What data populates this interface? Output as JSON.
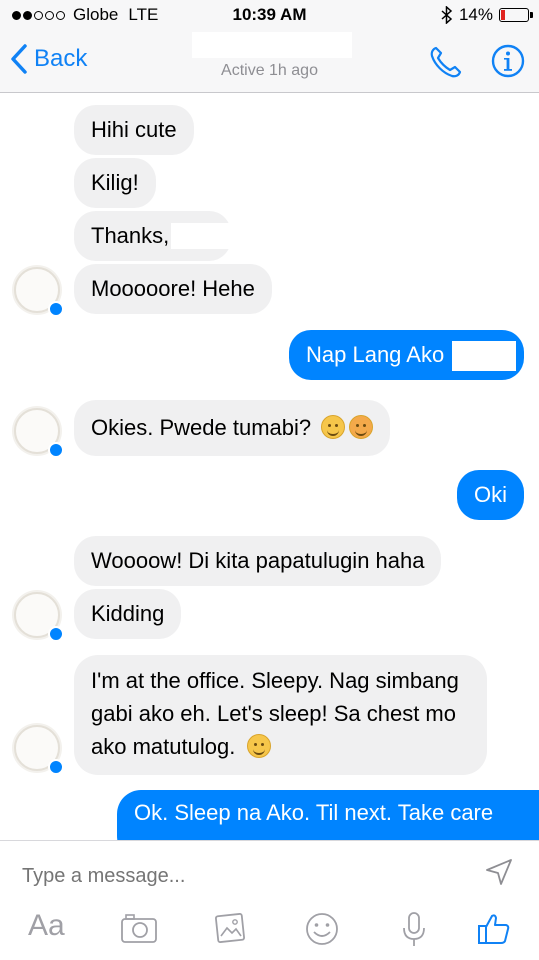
{
  "status_bar": {
    "carrier": "Globe",
    "network": "LTE",
    "time": "10:39 AM",
    "battery": "14%",
    "battery_level": 0.14
  },
  "header": {
    "back_label": "Back",
    "subtitle": "Active 1h ago",
    "icons": [
      "phone-icon",
      "info-icon"
    ]
  },
  "messages": [
    {
      "from": "them",
      "text": "Hihi cute"
    },
    {
      "from": "them",
      "text": "Kilig!"
    },
    {
      "from": "them",
      "text": "Thanks,"
    },
    {
      "from": "them",
      "text": "Mooooore! Hehe"
    },
    {
      "from": "me",
      "text": "Nap Lang Ako"
    },
    {
      "from": "them",
      "text": "Okies. Pwede tumabi?",
      "emoji": [
        "grin-emoji",
        "tongue-emoji"
      ]
    },
    {
      "from": "me",
      "text": "Oki"
    },
    {
      "from": "them",
      "text": "Woooow! Di kita papatulugin haha"
    },
    {
      "from": "them",
      "text": "Kidding"
    },
    {
      "from": "them",
      "text": "I'm at the office. Sleepy. Nag simbang gabi ako eh. Let's sleep! Sa chest mo ako matutulog.",
      "emoji": [
        "blush-emoji"
      ]
    },
    {
      "from": "me",
      "text": "Ok. Sleep na Ako. Til next. Take care"
    }
  ],
  "composer": {
    "placeholder": "Type a message...",
    "aa_label": "Aa",
    "tools": [
      "camera-icon",
      "gallery-icon",
      "smiley-icon",
      "microphone-icon",
      "thumbs-up-icon"
    ]
  },
  "colors": {
    "accent": "#1082f5",
    "outgoing_bubble": "#0084ff",
    "incoming_bubble": "#f0f0f1"
  }
}
